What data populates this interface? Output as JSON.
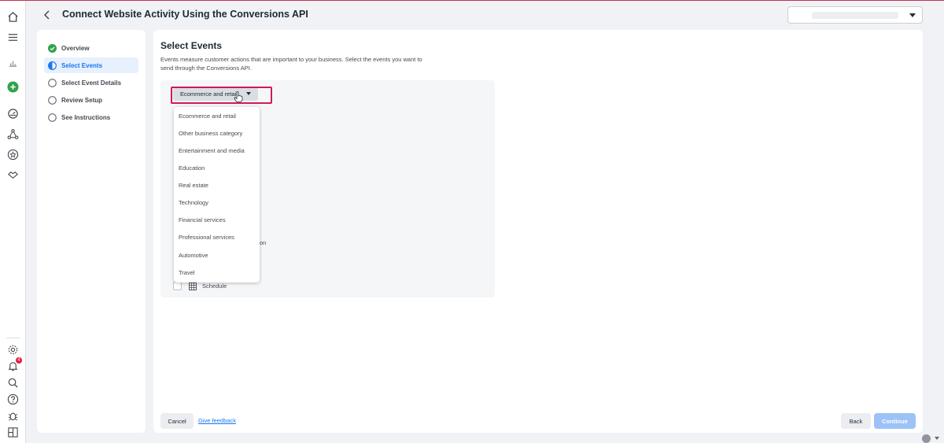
{
  "header": {
    "title": "Connect Website Activity Using the Conversions API"
  },
  "rail": {
    "icons": [
      "home-icon",
      "menu-icon",
      "chart-icon",
      "create-icon",
      "gauge-icon",
      "network-icon",
      "star-icon",
      "handshake-icon",
      "gear-icon",
      "bell-icon",
      "search-icon",
      "help-icon",
      "bug-icon",
      "panel-icon"
    ],
    "notification_count": "4"
  },
  "steps": [
    {
      "label": "Overview",
      "state": "complete"
    },
    {
      "label": "Select Events",
      "state": "active"
    },
    {
      "label": "Select Event Details",
      "state": "pending"
    },
    {
      "label": "Review Setup",
      "state": "pending"
    },
    {
      "label": "See Instructions",
      "state": "pending"
    }
  ],
  "main": {
    "title": "Select Events",
    "description": "Events measure customer actions that are important to your business. Select the events you want to send through the Conversions API.",
    "category_dropdown": {
      "selected": "Ecommerce and retail",
      "options": [
        "Ecommerce and retail",
        "Other business category",
        "Entertainment and media",
        "Education",
        "Real estate",
        "Technology",
        "Financial services",
        "Professional services",
        "Automotive",
        "Travel"
      ]
    },
    "partial_row_text": "on",
    "schedule_label": "Schedule"
  },
  "footer": {
    "cancel_label": "Cancel",
    "feedback_label": "Give feedback",
    "back_label": "Back",
    "continue_label": "Continue"
  },
  "colors": {
    "accent": "#1877f2",
    "highlight_border": "#d11a54",
    "continue_disabled": "#9cc2f8",
    "complete_green": "#31a24c"
  }
}
